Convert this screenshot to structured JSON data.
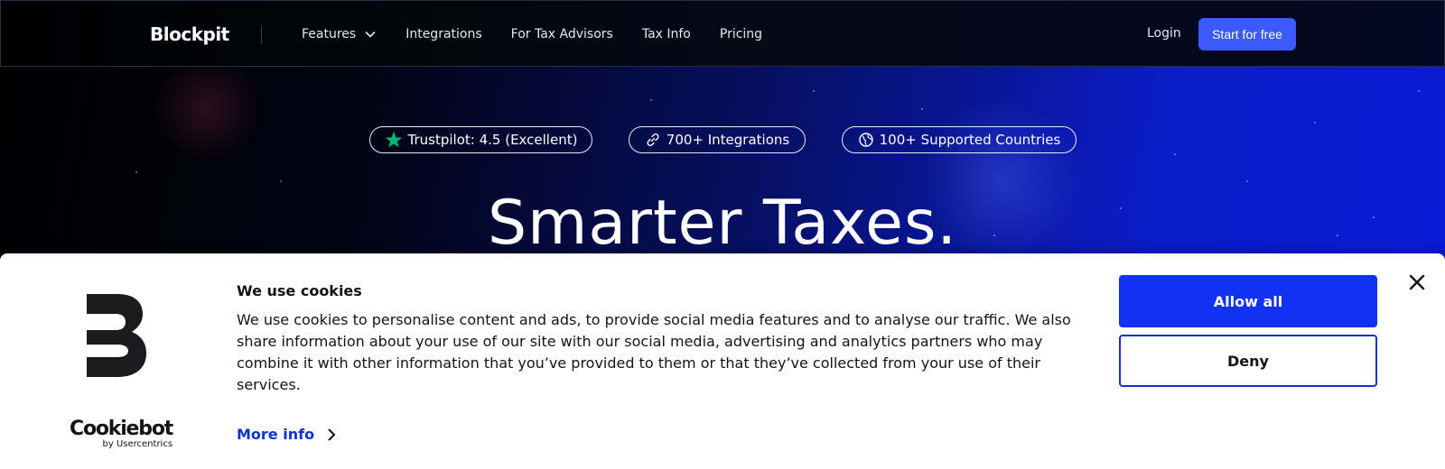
{
  "nav": {
    "logo": "Blockpit",
    "links": [
      "Features",
      "Integrations",
      "For Tax Advisors",
      "Tax Info",
      "Pricing"
    ],
    "login": "Login",
    "cta": "Start for free"
  },
  "hero": {
    "badges": [
      {
        "text": "Trustpilot: 4.5 (Excellent)",
        "icon": "star-icon"
      },
      {
        "text": "700+ Integrations",
        "icon": "link-icon"
      },
      {
        "text": "100+ Supported Countries",
        "icon": "globe-icon"
      }
    ],
    "title": "Smarter Taxes."
  },
  "cookie": {
    "title": "We use cookies",
    "text": "We use cookies to personalise content and ads, to provide social media features and to analyse our traffic. We also share information about your use of our site with our social media, advertising and analytics partners who may combine it with other information that you’ve provided to them or that they’ve collected from your use of their services.",
    "more_info": "More info",
    "allow": "Allow all",
    "deny": "Deny",
    "provider": "Cookiebot",
    "provider_sub": "by Usercentrics"
  },
  "colors": {
    "accent": "#3b5bff",
    "cookie_primary": "#1032f5",
    "trustpilot_star": "#00b67a"
  }
}
